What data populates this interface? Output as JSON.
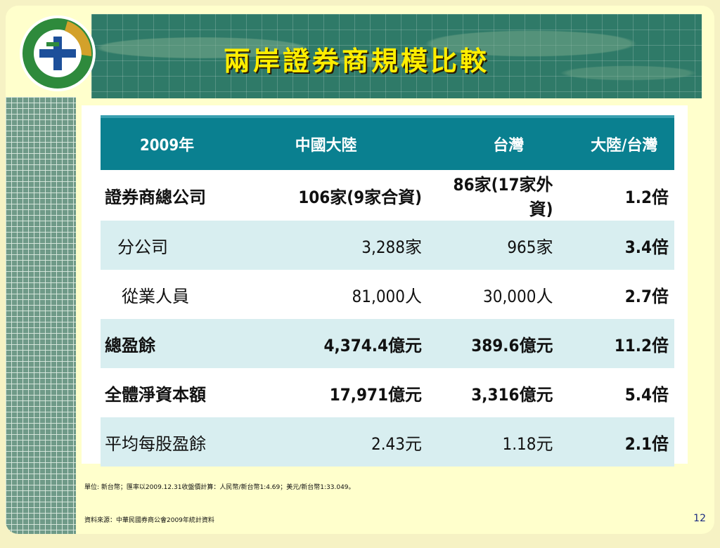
{
  "slide": {
    "title": "兩岸證券商規模比較",
    "page_number": "12"
  },
  "table": {
    "headers": [
      "2009年",
      "中國大陸",
      "台灣",
      "大陸/台灣"
    ],
    "rows": [
      {
        "label": "證券商總公司",
        "china": "106家(9家合資)",
        "taiwan": "86家(17家外資)",
        "ratio": "1.2倍"
      },
      {
        "label": "分公司",
        "china": "3,288家",
        "taiwan": "965家",
        "ratio": "3.4倍"
      },
      {
        "label": "從業人員",
        "china": "81,000人",
        "taiwan": "30,000人",
        "ratio": "2.7倍"
      },
      {
        "label": "總盈餘",
        "china": "4,374.4億元",
        "taiwan": "389.6億元",
        "ratio": "11.2倍"
      },
      {
        "label": "全體淨資本額",
        "china": "17,971億元",
        "taiwan": "3,316億元",
        "ratio": "5.4倍"
      },
      {
        "label": "平均每股盈餘",
        "china": "2.43元",
        "taiwan": "1.18元",
        "ratio": "2.1倍"
      }
    ]
  },
  "notes": {
    "unit": "單位: 新台幣；匯率以2009.12.31收盤價計算：人民幣/新台幣1:4.69；美元/新台幣1:33.049。",
    "source": "資料來源：中華民國券商公會2009年統計資料"
  },
  "colors": {
    "header_bg": "#0a8090",
    "band_bg": "#d8eef0",
    "ratio_text": "#e03a00",
    "title_text": "#ffee00"
  }
}
